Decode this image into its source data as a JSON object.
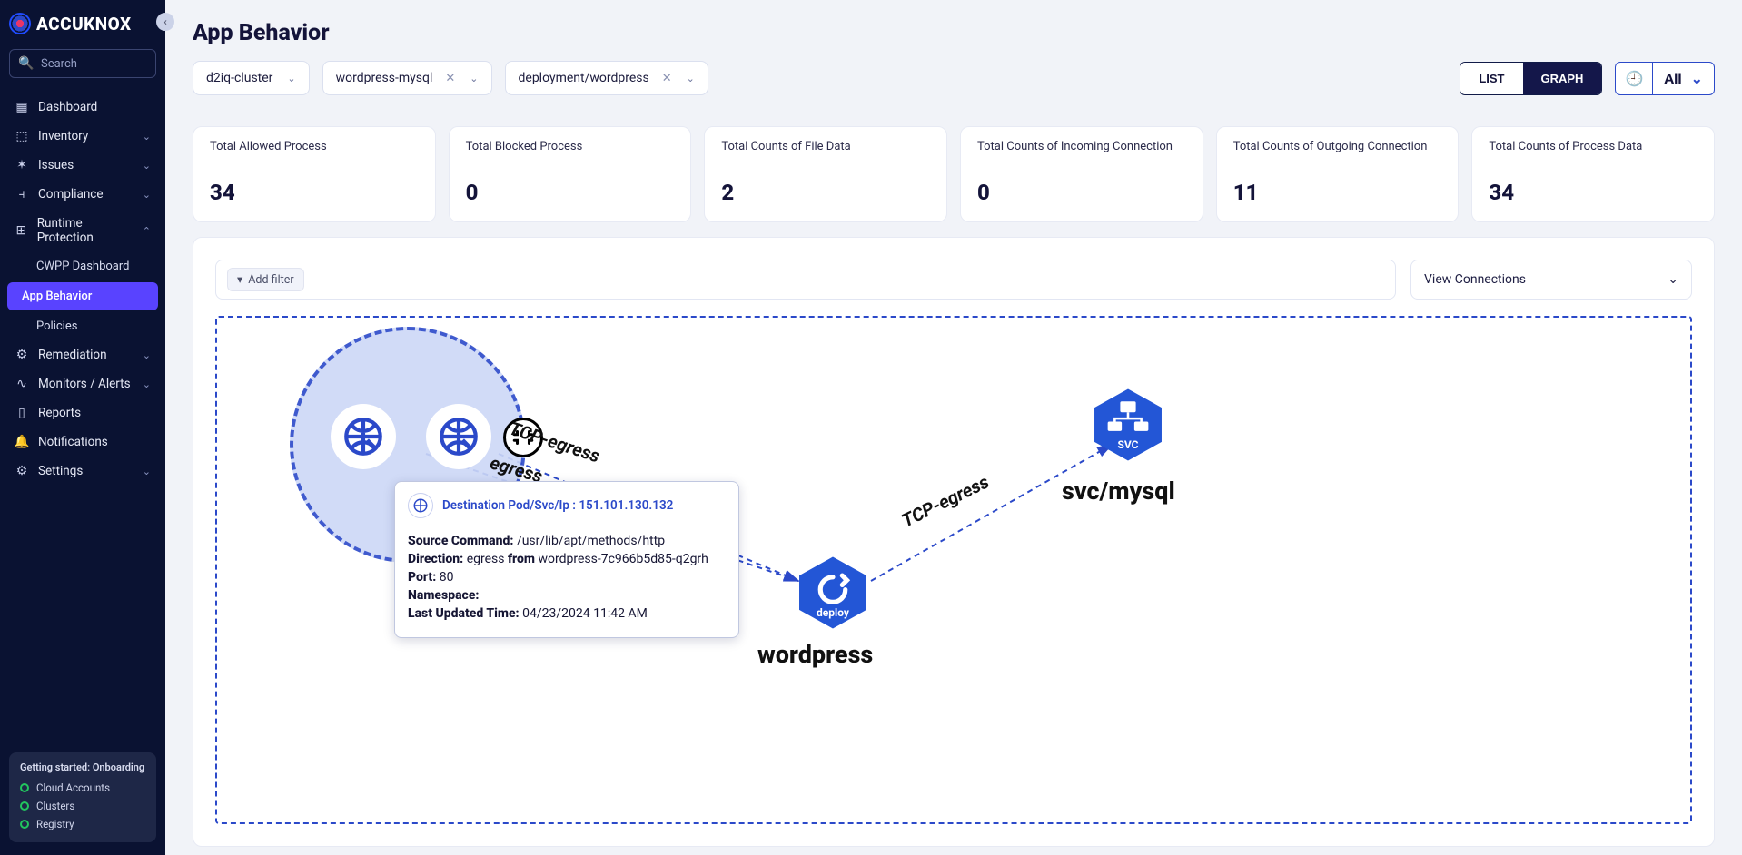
{
  "brand": "ACCUKNOX",
  "search_placeholder": "Search",
  "nav": {
    "dashboard": "Dashboard",
    "inventory": "Inventory",
    "issues": "Issues",
    "compliance": "Compliance",
    "runtime": "Runtime Protection",
    "runtime_items": {
      "cwpp": "CWPP Dashboard",
      "appbeh": "App Behavior",
      "policies": "Policies"
    },
    "remediation": "Remediation",
    "monitors": "Monitors / Alerts",
    "reports": "Reports",
    "notifications": "Notifications",
    "settings": "Settings"
  },
  "onboard": {
    "title": "Getting started: Onboarding",
    "cloud": "Cloud Accounts",
    "clusters": "Clusters",
    "registry": "Registry"
  },
  "page_title": "App Behavior",
  "filters": {
    "cluster": "d2iq-cluster",
    "namespace": "wordpress-mysql",
    "workload": "deployment/wordpress"
  },
  "view": {
    "list": "LIST",
    "graph": "GRAPH",
    "all": "All"
  },
  "stats": [
    {
      "label": "Total Allowed Process",
      "value": "34"
    },
    {
      "label": "Total Blocked Process",
      "value": "0"
    },
    {
      "label": "Total Counts of File Data",
      "value": "2"
    },
    {
      "label": "Total Counts of Incoming Connection",
      "value": "0"
    },
    {
      "label": "Total Counts of Outgoing Connection",
      "value": "11"
    },
    {
      "label": "Total Counts of Process Data",
      "value": "34"
    }
  ],
  "addfilter": "Add filter",
  "viewconn": "View Connections",
  "graph": {
    "edge1": "TCP-egress",
    "edge2": "TCP-egress",
    "edge3": "egress",
    "wordpress": "wordpress",
    "mysql": "svc/mysql",
    "deploy_badge": "deploy",
    "svc_badge": "SVC"
  },
  "tooltip": {
    "title_prefix": "Destination Pod/Svc/Ip : ",
    "title_value": "151.101.130.132",
    "src_cmd_k": "Source Command:",
    "src_cmd_v": "/usr/lib/apt/methods/http",
    "dir_k": "Direction:",
    "dir_v1": "egress",
    "dir_from": "from",
    "dir_v2": "wordpress-7c966b5d85-q2grh",
    "port_k": "Port:",
    "port_v": "80",
    "ns_k": "Namespace:",
    "time_k": "Last Updated Time:",
    "time_v": "04/23/2024 11:42 AM"
  }
}
